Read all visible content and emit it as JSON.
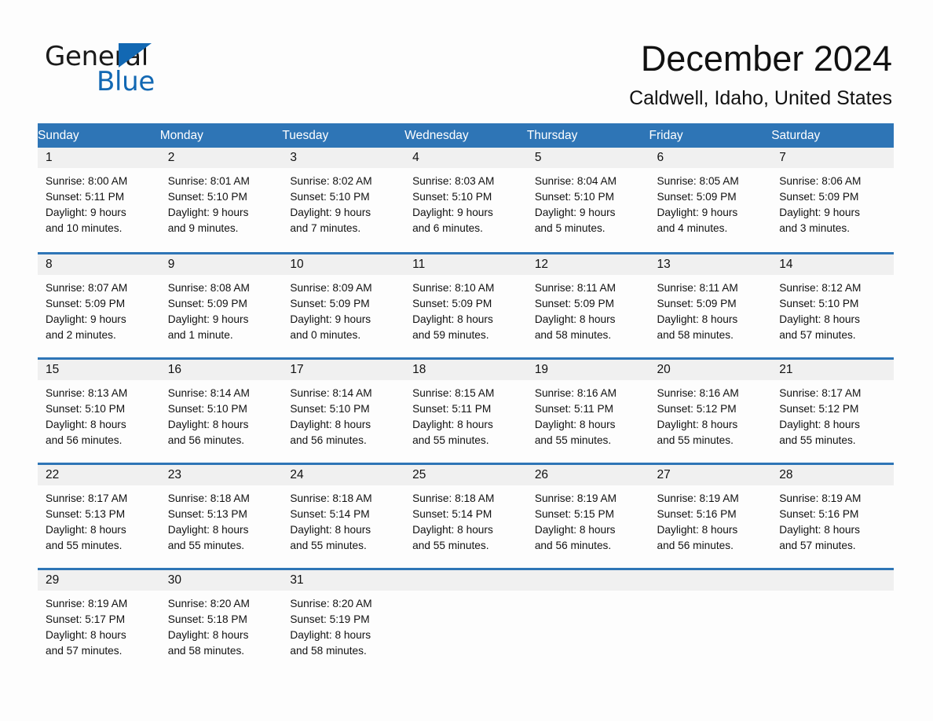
{
  "brand": {
    "name_part1": "General",
    "name_part2": "Blue"
  },
  "header": {
    "month_title": "December 2024",
    "location": "Caldwell, Idaho, United States"
  },
  "theme": {
    "header_blue": "#2e75b6",
    "logo_blue": "#1268b3",
    "daynum_band": "#f0f0f0",
    "page_bg": "#fdfdfd",
    "text": "#111111"
  },
  "calendar": {
    "weekday_headers": [
      "Sunday",
      "Monday",
      "Tuesday",
      "Wednesday",
      "Thursday",
      "Friday",
      "Saturday"
    ],
    "weeks": [
      [
        {
          "day": "1",
          "sunrise": "Sunrise: 8:00 AM",
          "sunset": "Sunset: 5:11 PM",
          "daylight_1": "Daylight: 9 hours",
          "daylight_2": "and 10 minutes."
        },
        {
          "day": "2",
          "sunrise": "Sunrise: 8:01 AM",
          "sunset": "Sunset: 5:10 PM",
          "daylight_1": "Daylight: 9 hours",
          "daylight_2": "and 9 minutes."
        },
        {
          "day": "3",
          "sunrise": "Sunrise: 8:02 AM",
          "sunset": "Sunset: 5:10 PM",
          "daylight_1": "Daylight: 9 hours",
          "daylight_2": "and 7 minutes."
        },
        {
          "day": "4",
          "sunrise": "Sunrise: 8:03 AM",
          "sunset": "Sunset: 5:10 PM",
          "daylight_1": "Daylight: 9 hours",
          "daylight_2": "and 6 minutes."
        },
        {
          "day": "5",
          "sunrise": "Sunrise: 8:04 AM",
          "sunset": "Sunset: 5:10 PM",
          "daylight_1": "Daylight: 9 hours",
          "daylight_2": "and 5 minutes."
        },
        {
          "day": "6",
          "sunrise": "Sunrise: 8:05 AM",
          "sunset": "Sunset: 5:09 PM",
          "daylight_1": "Daylight: 9 hours",
          "daylight_2": "and 4 minutes."
        },
        {
          "day": "7",
          "sunrise": "Sunrise: 8:06 AM",
          "sunset": "Sunset: 5:09 PM",
          "daylight_1": "Daylight: 9 hours",
          "daylight_2": "and 3 minutes."
        }
      ],
      [
        {
          "day": "8",
          "sunrise": "Sunrise: 8:07 AM",
          "sunset": "Sunset: 5:09 PM",
          "daylight_1": "Daylight: 9 hours",
          "daylight_2": "and 2 minutes."
        },
        {
          "day": "9",
          "sunrise": "Sunrise: 8:08 AM",
          "sunset": "Sunset: 5:09 PM",
          "daylight_1": "Daylight: 9 hours",
          "daylight_2": "and 1 minute."
        },
        {
          "day": "10",
          "sunrise": "Sunrise: 8:09 AM",
          "sunset": "Sunset: 5:09 PM",
          "daylight_1": "Daylight: 9 hours",
          "daylight_2": "and 0 minutes."
        },
        {
          "day": "11",
          "sunrise": "Sunrise: 8:10 AM",
          "sunset": "Sunset: 5:09 PM",
          "daylight_1": "Daylight: 8 hours",
          "daylight_2": "and 59 minutes."
        },
        {
          "day": "12",
          "sunrise": "Sunrise: 8:11 AM",
          "sunset": "Sunset: 5:09 PM",
          "daylight_1": "Daylight: 8 hours",
          "daylight_2": "and 58 minutes."
        },
        {
          "day": "13",
          "sunrise": "Sunrise: 8:11 AM",
          "sunset": "Sunset: 5:09 PM",
          "daylight_1": "Daylight: 8 hours",
          "daylight_2": "and 58 minutes."
        },
        {
          "day": "14",
          "sunrise": "Sunrise: 8:12 AM",
          "sunset": "Sunset: 5:10 PM",
          "daylight_1": "Daylight: 8 hours",
          "daylight_2": "and 57 minutes."
        }
      ],
      [
        {
          "day": "15",
          "sunrise": "Sunrise: 8:13 AM",
          "sunset": "Sunset: 5:10 PM",
          "daylight_1": "Daylight: 8 hours",
          "daylight_2": "and 56 minutes."
        },
        {
          "day": "16",
          "sunrise": "Sunrise: 8:14 AM",
          "sunset": "Sunset: 5:10 PM",
          "daylight_1": "Daylight: 8 hours",
          "daylight_2": "and 56 minutes."
        },
        {
          "day": "17",
          "sunrise": "Sunrise: 8:14 AM",
          "sunset": "Sunset: 5:10 PM",
          "daylight_1": "Daylight: 8 hours",
          "daylight_2": "and 56 minutes."
        },
        {
          "day": "18",
          "sunrise": "Sunrise: 8:15 AM",
          "sunset": "Sunset: 5:11 PM",
          "daylight_1": "Daylight: 8 hours",
          "daylight_2": "and 55 minutes."
        },
        {
          "day": "19",
          "sunrise": "Sunrise: 8:16 AM",
          "sunset": "Sunset: 5:11 PM",
          "daylight_1": "Daylight: 8 hours",
          "daylight_2": "and 55 minutes."
        },
        {
          "day": "20",
          "sunrise": "Sunrise: 8:16 AM",
          "sunset": "Sunset: 5:12 PM",
          "daylight_1": "Daylight: 8 hours",
          "daylight_2": "and 55 minutes."
        },
        {
          "day": "21",
          "sunrise": "Sunrise: 8:17 AM",
          "sunset": "Sunset: 5:12 PM",
          "daylight_1": "Daylight: 8 hours",
          "daylight_2": "and 55 minutes."
        }
      ],
      [
        {
          "day": "22",
          "sunrise": "Sunrise: 8:17 AM",
          "sunset": "Sunset: 5:13 PM",
          "daylight_1": "Daylight: 8 hours",
          "daylight_2": "and 55 minutes."
        },
        {
          "day": "23",
          "sunrise": "Sunrise: 8:18 AM",
          "sunset": "Sunset: 5:13 PM",
          "daylight_1": "Daylight: 8 hours",
          "daylight_2": "and 55 minutes."
        },
        {
          "day": "24",
          "sunrise": "Sunrise: 8:18 AM",
          "sunset": "Sunset: 5:14 PM",
          "daylight_1": "Daylight: 8 hours",
          "daylight_2": "and 55 minutes."
        },
        {
          "day": "25",
          "sunrise": "Sunrise: 8:18 AM",
          "sunset": "Sunset: 5:14 PM",
          "daylight_1": "Daylight: 8 hours",
          "daylight_2": "and 55 minutes."
        },
        {
          "day": "26",
          "sunrise": "Sunrise: 8:19 AM",
          "sunset": "Sunset: 5:15 PM",
          "daylight_1": "Daylight: 8 hours",
          "daylight_2": "and 56 minutes."
        },
        {
          "day": "27",
          "sunrise": "Sunrise: 8:19 AM",
          "sunset": "Sunset: 5:16 PM",
          "daylight_1": "Daylight: 8 hours",
          "daylight_2": "and 56 minutes."
        },
        {
          "day": "28",
          "sunrise": "Sunrise: 8:19 AM",
          "sunset": "Sunset: 5:16 PM",
          "daylight_1": "Daylight: 8 hours",
          "daylight_2": "and 57 minutes."
        }
      ],
      [
        {
          "day": "29",
          "sunrise": "Sunrise: 8:19 AM",
          "sunset": "Sunset: 5:17 PM",
          "daylight_1": "Daylight: 8 hours",
          "daylight_2": "and 57 minutes."
        },
        {
          "day": "30",
          "sunrise": "Sunrise: 8:20 AM",
          "sunset": "Sunset: 5:18 PM",
          "daylight_1": "Daylight: 8 hours",
          "daylight_2": "and 58 minutes."
        },
        {
          "day": "31",
          "sunrise": "Sunrise: 8:20 AM",
          "sunset": "Sunset: 5:19 PM",
          "daylight_1": "Daylight: 8 hours",
          "daylight_2": "and 58 minutes."
        },
        {
          "day": "",
          "sunrise": "",
          "sunset": "",
          "daylight_1": "",
          "daylight_2": ""
        },
        {
          "day": "",
          "sunrise": "",
          "sunset": "",
          "daylight_1": "",
          "daylight_2": ""
        },
        {
          "day": "",
          "sunrise": "",
          "sunset": "",
          "daylight_1": "",
          "daylight_2": ""
        },
        {
          "day": "",
          "sunrise": "",
          "sunset": "",
          "daylight_1": "",
          "daylight_2": ""
        }
      ]
    ]
  }
}
